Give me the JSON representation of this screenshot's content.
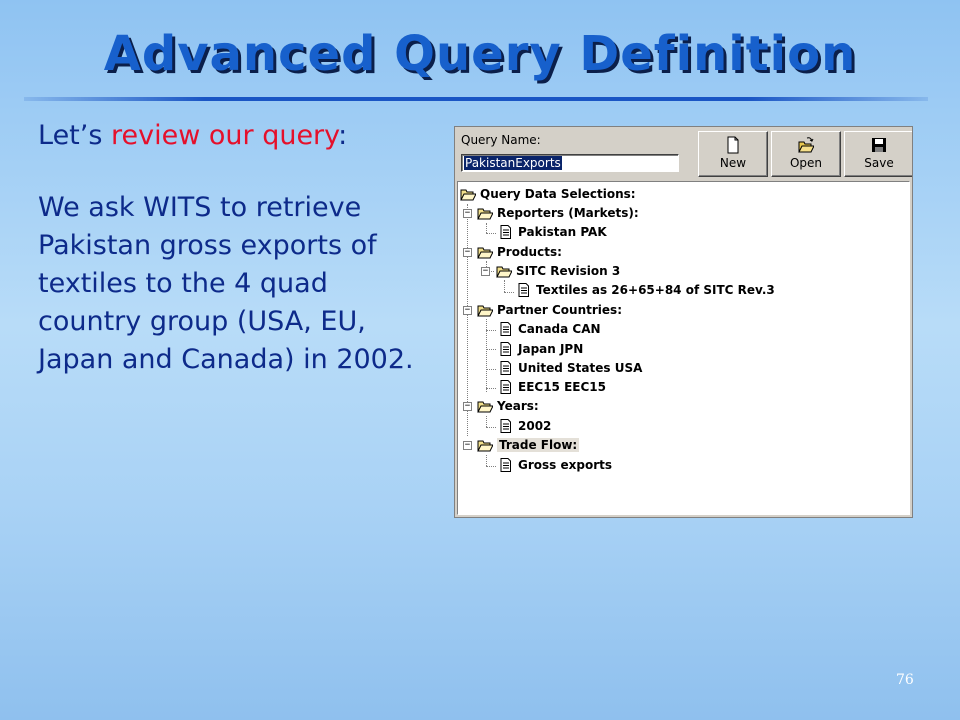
{
  "slide": {
    "title": "Advanced Query Definition",
    "intro_prefix": "Let’s ",
    "intro_highlight": "review our query",
    "intro_suffix": ":",
    "paragraph": "We ask WITS to retrieve Pakistan gross exports of textiles to the 4 quad country group (USA, EU, Japan and Canada) in 2002.",
    "page_number": "76"
  },
  "query_panel": {
    "name_label": "Query Name:",
    "name_value": "PakistanExports",
    "toolbar": {
      "new_label": "New",
      "open_label": "Open",
      "save_label": "Save"
    },
    "tree": {
      "root": "Query Data Selections:",
      "reporters": "Reporters (Markets):",
      "reporter_1": "Pakistan  PAK",
      "products": "Products:",
      "sitc": "SITC Revision 3",
      "sitc_item": "Textiles as 26+65+84 of SITC Rev.3",
      "partners": "Partner Countries:",
      "partner_1": "Canada  CAN",
      "partner_2": "Japan  JPN",
      "partner_3": "United States  USA",
      "partner_4": "EEC15  EEC15",
      "years": "Years:",
      "year_1": "2002",
      "trade_flow": "Trade Flow:",
      "flow_1": "Gross exports"
    }
  },
  "colors": {
    "title": "#1760cc",
    "body_text": "#0d2a8a",
    "highlight": "#e5102b",
    "background": "#a9d2f5"
  }
}
